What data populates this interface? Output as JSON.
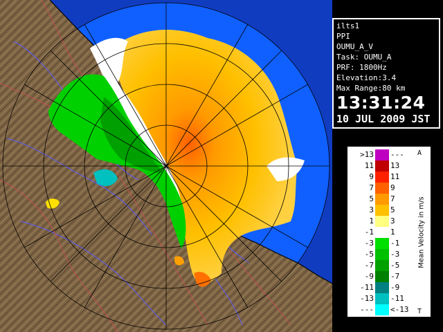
{
  "info": {
    "site": "ilts1",
    "product": "PPI",
    "dataset": "OUMU_A_V",
    "task": "Task: OUMU_A",
    "prf": "PRF: 1800Hz",
    "elevation": "Elevation:3.4",
    "max_range": "Max Range:80 km",
    "time": "13:31:24",
    "date": "10 JUL 2009 JST"
  },
  "legend": {
    "title": "Mean Velocity in m/s",
    "arrow_top": "A",
    "arrow_bottom": "T",
    "rows": [
      {
        "left": ">13",
        "right": "---",
        "color": "#c000c0"
      },
      {
        "left": "11",
        "right": "13",
        "color": "#c00000"
      },
      {
        "left": "9",
        "right": "11",
        "color": "#ff2000"
      },
      {
        "left": "7",
        "right": "9",
        "color": "#ff6000"
      },
      {
        "left": "5",
        "right": "7",
        "color": "#ff9a00"
      },
      {
        "left": "3",
        "right": "5",
        "color": "#ffc000"
      },
      {
        "left": "1",
        "right": "3",
        "color": "#ffff80"
      },
      {
        "left": "-1",
        "right": "1",
        "color": "#ffffff"
      },
      {
        "left": "-3",
        "right": "-1",
        "color": "#00e000"
      },
      {
        "left": "-5",
        "right": "-3",
        "color": "#00c000"
      },
      {
        "left": "-7",
        "right": "-5",
        "color": "#00a000"
      },
      {
        "left": "-9",
        "right": "-7",
        "color": "#008000"
      },
      {
        "left": "-11",
        "right": "-9",
        "color": "#008080"
      },
      {
        "left": "-13",
        "right": "-11",
        "color": "#00c0c0"
      },
      {
        "left": "---",
        "right": "<-13",
        "color": "#00ffff"
      }
    ]
  },
  "colors": {
    "sea": "#1060ff",
    "sea_out": "#103cc0",
    "land": "#7a6040"
  }
}
